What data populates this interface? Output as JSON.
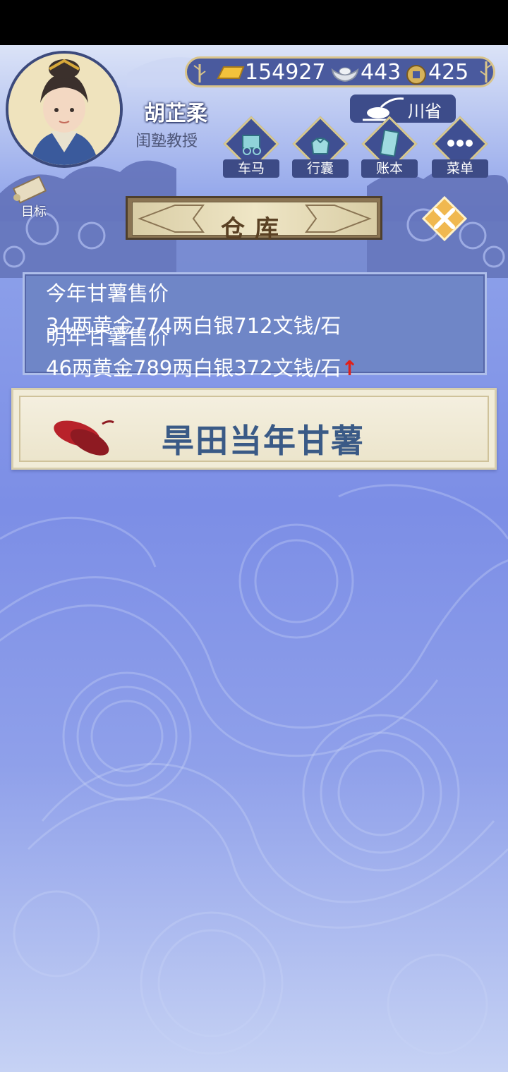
{
  "player": {
    "name": "胡芷柔",
    "title": "闺塾教授"
  },
  "currency": {
    "gold": "154927",
    "silver": "443",
    "coins": "425"
  },
  "region": "川省",
  "nav": [
    {
      "label": "车马",
      "icon": "carriage-icon"
    },
    {
      "label": "行囊",
      "icon": "bundle-icon"
    },
    {
      "label": "账本",
      "icon": "ledger-icon"
    },
    {
      "label": "菜单",
      "icon": "menu-dots-icon"
    }
  ],
  "goal_label": "目标",
  "page_title": "仓库",
  "prices": {
    "this_year_label": "今年甘薯售价",
    "this_year_value": "34两黄金774两白银712文钱/石",
    "next_year_label": "明年甘薯售价",
    "next_year_value": "46两黄金789两白银372文钱/石",
    "trend_symbol": "↑"
  },
  "item": {
    "name": "旱田当年甘薯",
    "icon": "sweet-potato-icon"
  },
  "colors": {
    "accent_gold": "#d9c48a",
    "panel_blue": "#6f86c7",
    "trend_up": "#e0201a"
  }
}
